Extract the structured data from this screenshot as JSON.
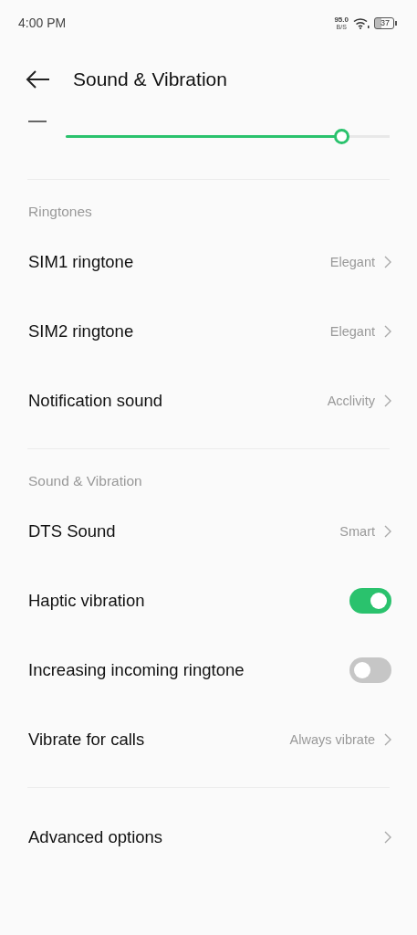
{
  "status_bar": {
    "time": "4:00 PM",
    "speed": "95.0",
    "speed_unit": "B/S",
    "battery": "37"
  },
  "header": {
    "title": "Sound & Vibration"
  },
  "volume": {
    "level": 0.85
  },
  "sections": [
    {
      "title": "Ringtones",
      "items": [
        {
          "kind": "link",
          "label": "SIM1 ringtone",
          "value": "Elegant"
        },
        {
          "kind": "link",
          "label": "SIM2 ringtone",
          "value": "Elegant"
        },
        {
          "kind": "link",
          "label": "Notification sound",
          "value": "Acclivity"
        }
      ]
    },
    {
      "title": "Sound & Vibration",
      "items": [
        {
          "kind": "link",
          "label": "DTS Sound",
          "value": "Smart"
        },
        {
          "kind": "toggle",
          "label": "Haptic vibration",
          "on": true
        },
        {
          "kind": "toggle",
          "label": "Increasing incoming ringtone",
          "on": false
        },
        {
          "kind": "link",
          "label": "Vibrate for calls",
          "value": "Always vibrate"
        }
      ]
    },
    {
      "items": [
        {
          "kind": "link",
          "label": "Advanced options"
        }
      ]
    }
  ]
}
